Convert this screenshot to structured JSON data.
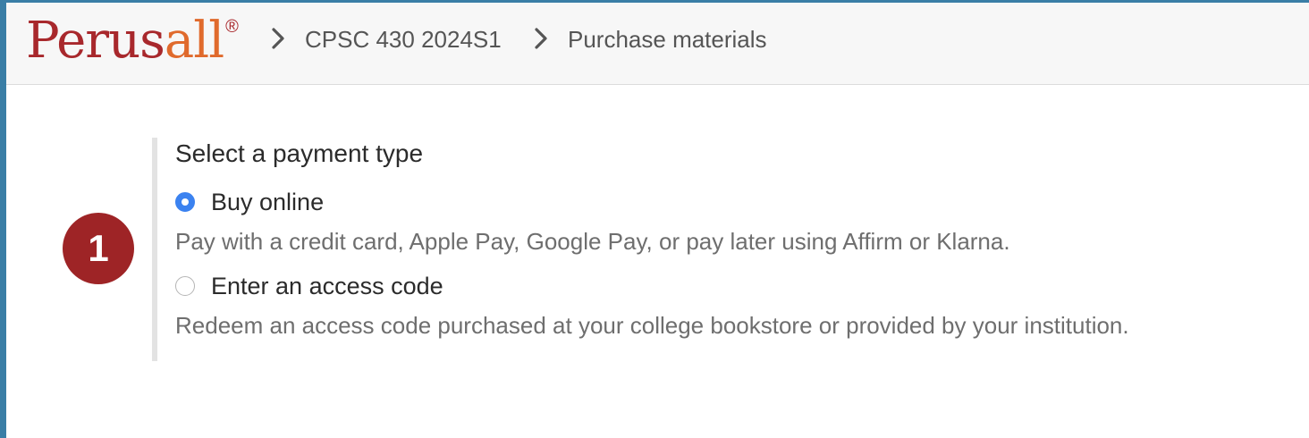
{
  "header": {
    "logo": {
      "part_a": "Perus",
      "part_b": "all",
      "registered": "®"
    },
    "breadcrumb": {
      "course": "CPSC 430 2024S1",
      "page": "Purchase materials"
    }
  },
  "step": {
    "number": "1",
    "title": "Select a payment type",
    "options": [
      {
        "label": "Buy online",
        "description": "Pay with a credit card, Apple Pay, Google Pay, or pay later using Affirm or Klarna.",
        "selected": true
      },
      {
        "label": "Enter an access code",
        "description": "Redeem an access code purchased at your college bookstore or provided by your institution.",
        "selected": false
      }
    ]
  },
  "colors": {
    "brand_red": "#a8282c",
    "brand_orange": "#e06a2c",
    "badge": "#9e2426",
    "radio_selected": "#3b82f0",
    "window_edge": "#3a7ea6"
  },
  "icons": {
    "breadcrumb_separator": "chevron-right-icon"
  }
}
